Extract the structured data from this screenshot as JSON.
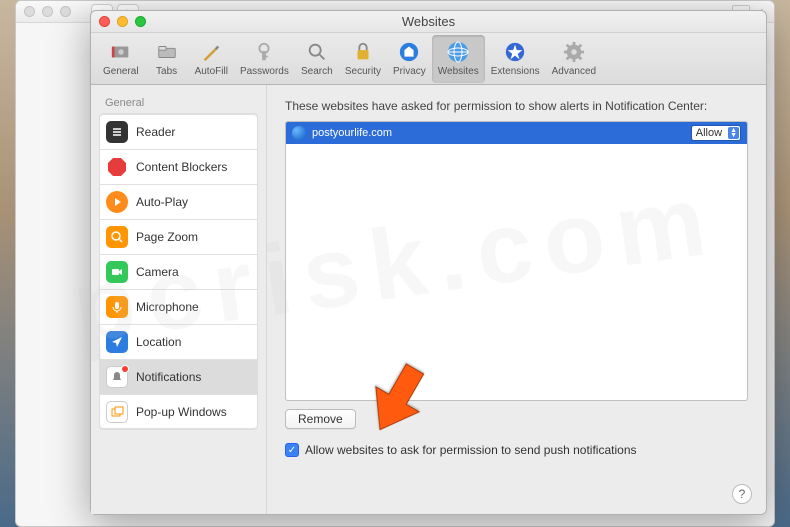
{
  "window": {
    "title": "Websites"
  },
  "toolbar": {
    "items": [
      {
        "label": "General"
      },
      {
        "label": "Tabs"
      },
      {
        "label": "AutoFill"
      },
      {
        "label": "Passwords"
      },
      {
        "label": "Search"
      },
      {
        "label": "Security"
      },
      {
        "label": "Privacy"
      },
      {
        "label": "Websites"
      },
      {
        "label": "Extensions"
      },
      {
        "label": "Advanced"
      }
    ]
  },
  "sidebar": {
    "group": "General",
    "items": [
      {
        "label": "Reader"
      },
      {
        "label": "Content Blockers"
      },
      {
        "label": "Auto-Play"
      },
      {
        "label": "Page Zoom"
      },
      {
        "label": "Camera"
      },
      {
        "label": "Microphone"
      },
      {
        "label": "Location"
      },
      {
        "label": "Notifications"
      },
      {
        "label": "Pop-up Windows"
      }
    ]
  },
  "panel": {
    "description": "These websites have asked for permission to show alerts in Notification Center:",
    "websites": [
      {
        "domain": "postyourlife.com",
        "permission": "Allow"
      }
    ],
    "remove_label": "Remove",
    "checkbox_label": "Allow websites to ask for permission to send push notifications",
    "checkbox_checked": true,
    "help": "?"
  }
}
